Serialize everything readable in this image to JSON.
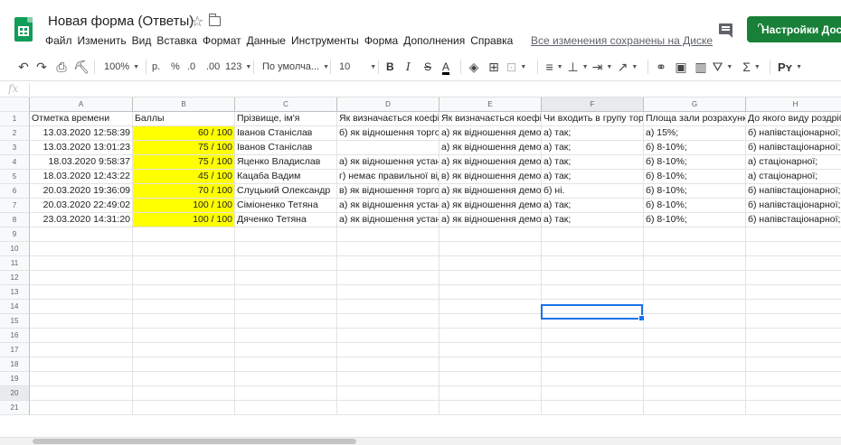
{
  "header": {
    "doc_title": "Новая форма (Ответы)",
    "menu": [
      "Файл",
      "Изменить",
      "Вид",
      "Вставка",
      "Формат",
      "Данные",
      "Инструменты",
      "Форма",
      "Дополнения",
      "Справка"
    ],
    "saved_status": "Все изменения сохранены на Диске",
    "settings_button": "Настройки Доступа"
  },
  "toolbar": {
    "zoom": "100%",
    "currency": "р.",
    "percent": "%",
    "dec_decrease": ".0",
    "dec_increase": ".00",
    "number_format": "123",
    "font": "По умолча...",
    "font_size": "10",
    "bold": "B",
    "italic": "I",
    "strike": "S",
    "text_color": "A",
    "sum": "Σ",
    "input_tools": "Рʏ"
  },
  "formula_bar": {
    "fx": "fx",
    "value": ""
  },
  "grid": {
    "active_column": "F",
    "active_row": "20",
    "columns": [
      "A",
      "B",
      "C",
      "D",
      "E",
      "F",
      "G",
      "H"
    ],
    "row_numbers": [
      "1",
      "2",
      "3",
      "4",
      "5",
      "6",
      "7",
      "8",
      "9",
      "10",
      "11",
      "12",
      "13",
      "14",
      "15",
      "16",
      "17",
      "18",
      "19",
      "20",
      "21"
    ],
    "headers": [
      "Отметка времени",
      "Баллы",
      "Прізвище, ім'я",
      "Як визначається коефіціє",
      "Як визначається коефіціє",
      "Чи входить в групу торгов",
      "Площа зали розрахунко",
      "До якого виду роздрібно"
    ],
    "rows": [
      [
        "13.03.2020 12:58:39",
        "60 / 100",
        "Іванов Станіслав",
        "б) як відношення торгової",
        "а) як відношення демонстр",
        "а) так;",
        "а) 15%;",
        "б) напівстаціонарної;"
      ],
      [
        "13.03.2020 13:01:23",
        "75 / 100",
        "Іванов Станіслав",
        "",
        "а) як відношення демонстр",
        "а) так;",
        "б) 8-10%;",
        "б) напівстаціонарної;"
      ],
      [
        "18.03.2020 9:58:37",
        "75 / 100",
        "Яценко Владислав",
        "а) як відношення установо",
        "а) як відношення демонстр",
        "а) так;",
        "б) 8-10%;",
        "а) стаціонарної;"
      ],
      [
        "18.03.2020 12:43:22",
        "45 / 100",
        "Кацаба Вадим",
        "г) немає правильної відпо",
        "в) як відношення демонстр",
        "а) так;",
        "б) 8-10%;",
        "а) стаціонарної;"
      ],
      [
        "20.03.2020 19:36:09",
        "70 / 100",
        "Слуцький Олександр",
        "в) як відношення торгової",
        "а) як відношення демонстр",
        "б) ні.",
        "б) 8-10%;",
        "б) напівстаціонарної;"
      ],
      [
        "20.03.2020 22:49:02",
        "100 / 100",
        "Сіміоненко Тетяна",
        "а) як відношення установо",
        "а) як відношення демонстр",
        "а) так;",
        "б) 8-10%;",
        "б) напівстаціонарної;"
      ],
      [
        "23.03.2020 14:31:20",
        "100 / 100",
        "Дяченко Тетяна",
        "а) як відношення установо",
        "а) як відношення демонстр",
        "а) так;",
        "б) 8-10%;",
        "б) напівстаціонарної;"
      ]
    ]
  },
  "colors": {
    "accent": "#188038",
    "selection": "#1a73e8",
    "highlight": "#ffff00"
  }
}
